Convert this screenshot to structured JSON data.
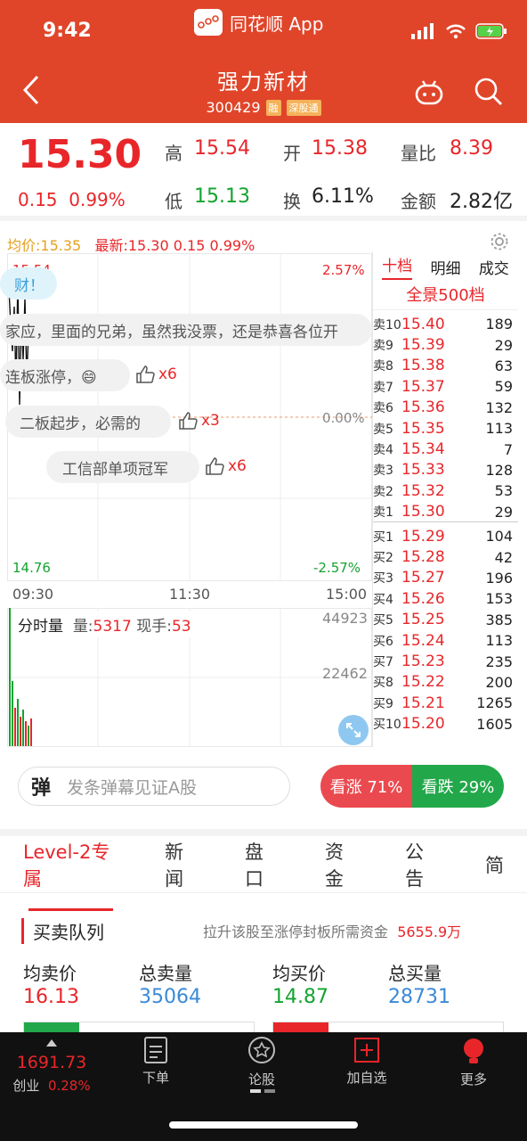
{
  "status_bar": {
    "time": "9:42",
    "app_name": "同花顺 App"
  },
  "header": {
    "title": "强力新材",
    "code": "300429",
    "tags": [
      "融",
      "深股通"
    ]
  },
  "quote": {
    "price": "15.30",
    "change": "0.15",
    "change_pct": "0.99%",
    "high_label": "高",
    "high": "15.54",
    "open_label": "开",
    "open": "15.38",
    "vol_ratio_label": "量比",
    "vol_ratio": "8.39",
    "low_label": "低",
    "low": "15.13",
    "turnover_label": "换",
    "turnover": "6.11%",
    "amount_label": "金额",
    "amount": "2.82亿"
  },
  "chart": {
    "avg_label": "均价:15.35",
    "latest_label": "最新:15.30",
    "latest_chg": "0.15",
    "latest_pct": "0.99%",
    "top_price": "15.54",
    "top_pct": "2.57%",
    "zero_pct": "0.00%",
    "bottom_price": "14.76",
    "bottom_pct": "-2.57%",
    "times": [
      "09:30",
      "11:30",
      "15:00"
    ],
    "vol_top": "44923",
    "vol_mid": "22462",
    "vol_title": "分时量",
    "vol_label": "量:",
    "vol_value": "5317",
    "hand_label": "现手:",
    "hand_value": "53"
  },
  "danmaku": [
    {
      "text": "财！"
    },
    {
      "text": "家应，里面的兄弟，虽然我没票，还是恭喜各位开"
    },
    {
      "text": "连板涨停，😄",
      "likes": "x6"
    },
    {
      "text": "二板起步，必需的",
      "likes": "x3"
    },
    {
      "text": "工信部单项冠军",
      "likes": "x6"
    }
  ],
  "orderbook": {
    "tabs": [
      "十档",
      "明细",
      "成交"
    ],
    "subtitle": "全景500档",
    "asks": [
      {
        "k": "卖10",
        "p": "15.40",
        "q": "189"
      },
      {
        "k": "卖9",
        "p": "15.39",
        "q": "29"
      },
      {
        "k": "卖8",
        "p": "15.38",
        "q": "63"
      },
      {
        "k": "卖7",
        "p": "15.37",
        "q": "59"
      },
      {
        "k": "卖6",
        "p": "15.36",
        "q": "132"
      },
      {
        "k": "卖5",
        "p": "15.35",
        "q": "113"
      },
      {
        "k": "卖4",
        "p": "15.34",
        "q": "7"
      },
      {
        "k": "卖3",
        "p": "15.33",
        "q": "128"
      },
      {
        "k": "卖2",
        "p": "15.32",
        "q": "53"
      },
      {
        "k": "卖1",
        "p": "15.30",
        "q": "29"
      }
    ],
    "bids": [
      {
        "k": "买1",
        "p": "15.29",
        "q": "104"
      },
      {
        "k": "买2",
        "p": "15.28",
        "q": "42"
      },
      {
        "k": "买3",
        "p": "15.27",
        "q": "196"
      },
      {
        "k": "买4",
        "p": "15.26",
        "q": "153"
      },
      {
        "k": "买5",
        "p": "15.25",
        "q": "385"
      },
      {
        "k": "买6",
        "p": "15.24",
        "q": "113"
      },
      {
        "k": "买7",
        "p": "15.23",
        "q": "235"
      },
      {
        "k": "买8",
        "p": "15.22",
        "q": "200"
      },
      {
        "k": "买9",
        "p": "15.21",
        "q": "1265"
      },
      {
        "k": "买10",
        "p": "15.20",
        "q": "1605"
      }
    ]
  },
  "bar": {
    "danmu_btn": "弹",
    "danmu_placeholder": "发条弹幕见证A股",
    "bull": "看涨 71%",
    "bear": "看跌 29%"
  },
  "tabs": [
    "Level-2专属",
    "新闻",
    "盘口",
    "资金",
    "公告",
    "简"
  ],
  "queue": {
    "title": "买卖队列",
    "note": "拉升该股至涨停封板所需资金",
    "note_value": "5655.9万",
    "avg_sell_label": "均卖价",
    "avg_sell": "16.13",
    "total_sell_label": "总卖量",
    "total_sell": "35064",
    "avg_buy_label": "均买价",
    "avg_buy": "14.87",
    "total_buy_label": "总买量",
    "total_buy": "28731"
  },
  "nav": {
    "index_value": "1691.73",
    "index_name": "创业",
    "index_pct": "0.28%",
    "items": [
      "下单",
      "论股",
      "加自选",
      "更多"
    ]
  },
  "colors": {
    "header": "#e0452a",
    "up": "#e8262a",
    "down": "#14a330"
  }
}
